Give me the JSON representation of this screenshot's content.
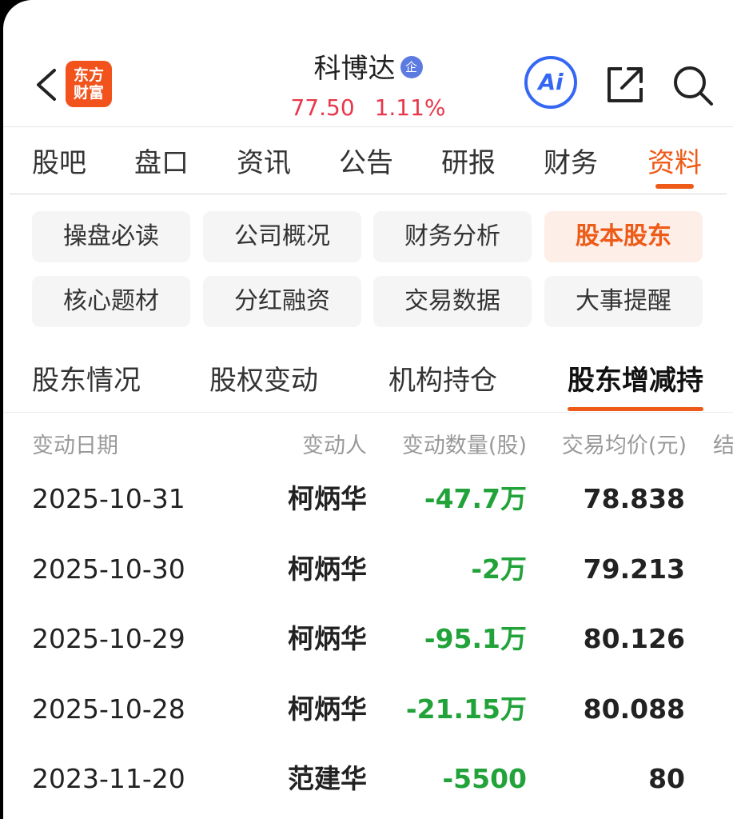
{
  "header": {
    "logo_line1": "东方",
    "logo_line2": "财富",
    "stock_name": "科博达",
    "badge": "企",
    "price": "77.50",
    "change_pct": "1.11%",
    "ai_label": "Ai"
  },
  "main_tabs": [
    "股吧",
    "盘口",
    "资讯",
    "公告",
    "研报",
    "财务",
    "资料"
  ],
  "active_main_tab": "资料",
  "categories": [
    [
      "操盘必读",
      "公司概况",
      "财务分析",
      "股本股东"
    ],
    [
      "核心题材",
      "分红融资",
      "交易数据",
      "大事提醒"
    ]
  ],
  "active_category": "股本股东",
  "sub_tabs": [
    "股东情况",
    "股权变动",
    "机构持仓",
    "股东增减持"
  ],
  "active_sub_tab": "股东增减持",
  "table": {
    "headers": [
      "变动日期",
      "变动人",
      "变动数量(股)",
      "交易均价(元)",
      "结"
    ],
    "rows": [
      {
        "date": "2025-10-31",
        "person": "柯炳华",
        "qty": "-47.7万",
        "price": "78.838"
      },
      {
        "date": "2025-10-30",
        "person": "柯炳华",
        "qty": "-2万",
        "price": "79.213"
      },
      {
        "date": "2025-10-29",
        "person": "柯炳华",
        "qty": "-95.1万",
        "price": "80.126"
      },
      {
        "date": "2025-10-28",
        "person": "柯炳华",
        "qty": "-21.15万",
        "price": "80.088"
      },
      {
        "date": "2023-11-20",
        "person": "范建华",
        "qty": "-5500",
        "price": "80"
      }
    ]
  },
  "colors": {
    "accent": "#ee5a17",
    "price_up": "#e8384b",
    "qty_negative": "#21a33a",
    "ai_blue": "#3567f5",
    "logo_bg": "#f2521c"
  }
}
